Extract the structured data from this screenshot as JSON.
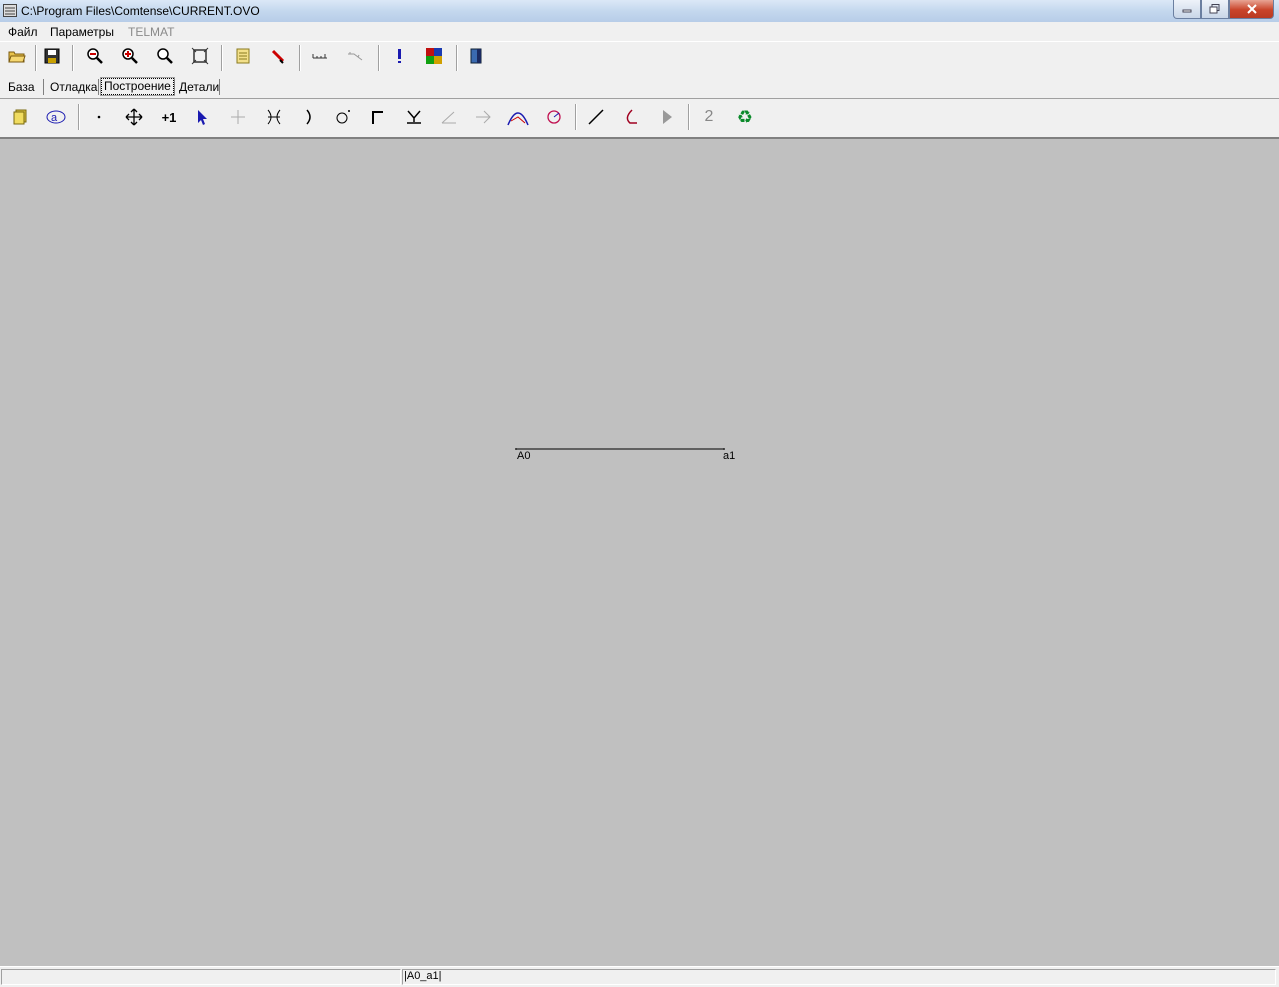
{
  "window": {
    "title": "C:\\Program Files\\Comtense\\CURRENT.OVO"
  },
  "menu": {
    "items": [
      "Файл",
      "Параметры",
      "TELMAT"
    ]
  },
  "tabs": {
    "items": [
      "База",
      "Отладка",
      "Построение",
      "Детали"
    ],
    "active": "Построение"
  },
  "toolbar2": {
    "plus_one": "+1",
    "two": "2"
  },
  "canvas": {
    "segment": {
      "start_label": "A0",
      "end_label": "a1"
    }
  },
  "status": {
    "text": "|A0_a1|"
  }
}
